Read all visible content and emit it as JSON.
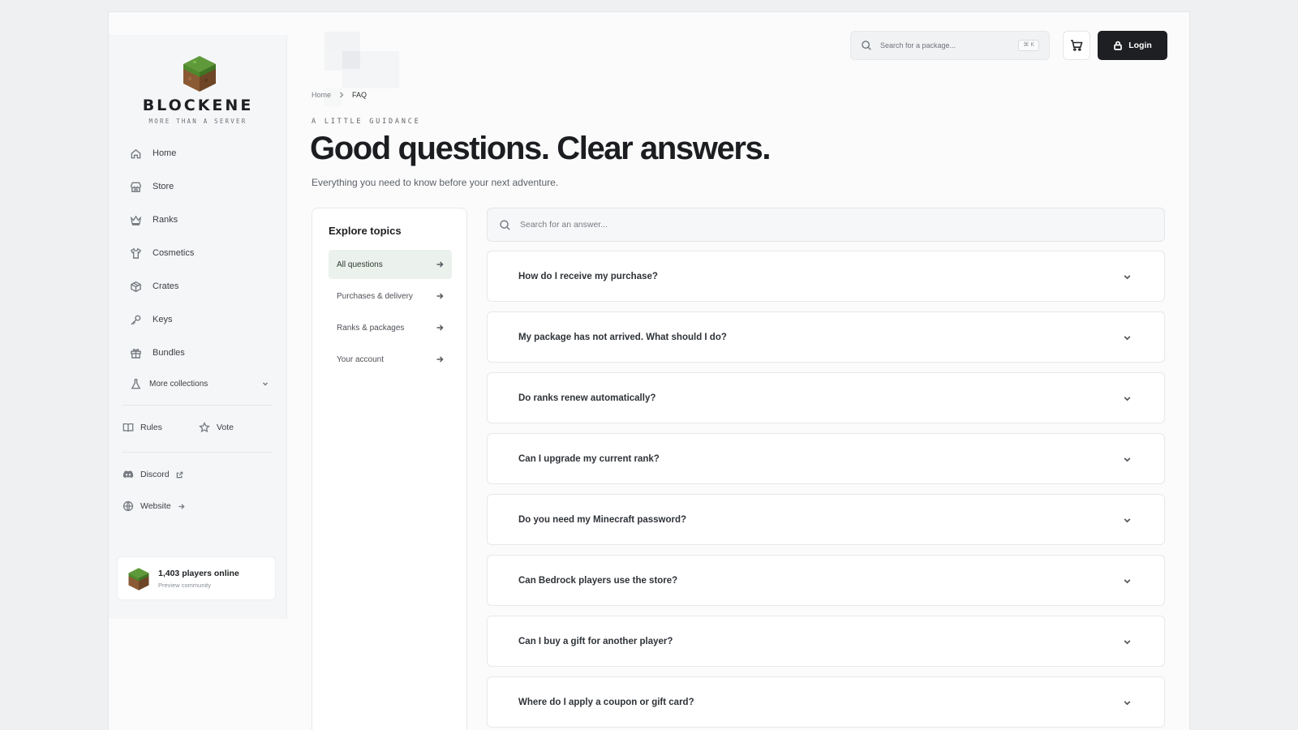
{
  "brand": {
    "name": "BLOCKENE",
    "tagline": "MORE THAN A SERVER"
  },
  "sidebar": {
    "items": [
      {
        "label": "Home",
        "icon": "home-icon"
      },
      {
        "label": "Store",
        "icon": "store-icon"
      },
      {
        "label": "Ranks",
        "icon": "crown-icon"
      },
      {
        "label": "Cosmetics",
        "icon": "shirt-icon"
      },
      {
        "label": "Crates",
        "icon": "box-icon"
      },
      {
        "label": "Keys",
        "icon": "key-icon"
      },
      {
        "label": "Bundles",
        "icon": "gift-icon"
      }
    ],
    "more": {
      "label": "More collections",
      "icon": "flask-icon"
    },
    "rules": "Rules",
    "vote": "Vote",
    "discord": "Discord",
    "website": "Website",
    "online": {
      "count": "1,403 players online",
      "sub": "Preview community"
    }
  },
  "header": {
    "search_placeholder": "Search for a package...",
    "shortcut": "⌘ K",
    "login": "Login"
  },
  "breadcrumb": {
    "home": "Home",
    "current": "FAQ"
  },
  "hero": {
    "eyebrow": "A LITTLE GUIDANCE",
    "title": "Good questions. Clear answers.",
    "subtitle": "Everything you need to know before your next adventure."
  },
  "topics": {
    "title": "Explore topics",
    "items": [
      {
        "label": "All questions",
        "active": true
      },
      {
        "label": "Purchases & delivery",
        "active": false
      },
      {
        "label": "Ranks & packages",
        "active": false
      },
      {
        "label": "Your account",
        "active": false
      }
    ]
  },
  "faq": {
    "search_placeholder": "Search for an answer...",
    "questions": [
      "How do I receive my purchase?",
      "My package has not arrived. What should I do?",
      "Do ranks renew automatically?",
      "Can I upgrade my current rank?",
      "Do you need my Minecraft password?",
      "Can Bedrock players use the store?",
      "Can I buy a gift for another player?",
      "Where do I apply a coupon or gift card?"
    ]
  },
  "colors": {
    "accent_dark": "#1d1f22",
    "active_topic_bg": "#ebf1ec",
    "page_bg": "#eef0f2"
  }
}
